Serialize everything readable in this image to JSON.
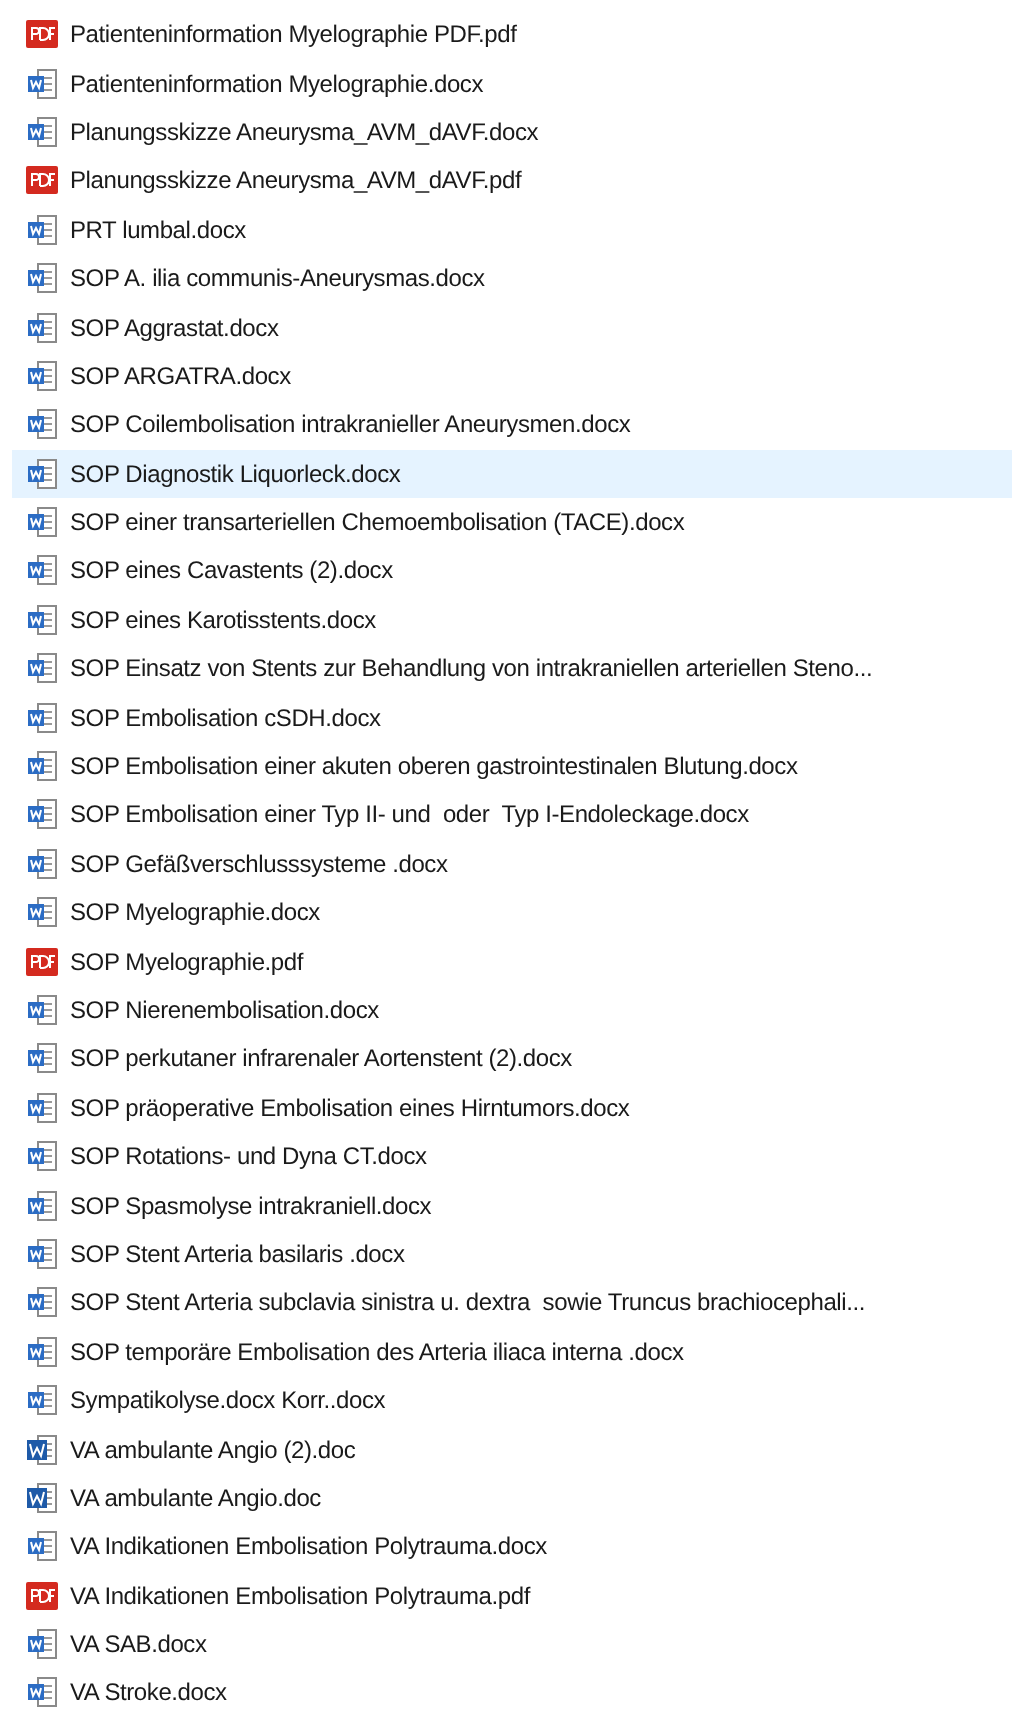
{
  "files": [
    {
      "name": "Patienteninformation Myelographie PDF.pdf",
      "kind": "pdf",
      "selected": false
    },
    {
      "name": "Patienteninformation Myelographie.docx",
      "kind": "docx",
      "selected": false
    },
    {
      "name": "Planungsskizze Aneurysma_AVM_dAVF.docx",
      "kind": "docx",
      "selected": false
    },
    {
      "name": "Planungsskizze Aneurysma_AVM_dAVF.pdf",
      "kind": "pdf",
      "selected": false
    },
    {
      "name": "PRT lumbal.docx",
      "kind": "docx",
      "selected": false
    },
    {
      "name": "SOP A. ilia communis-Aneurysmas.docx",
      "kind": "docx",
      "selected": false
    },
    {
      "name": "SOP Aggrastat.docx",
      "kind": "docx",
      "selected": false
    },
    {
      "name": "SOP ARGATRA.docx",
      "kind": "docx",
      "selected": false
    },
    {
      "name": "SOP Coilembolisation intrakranieller Aneurysmen.docx",
      "kind": "docx",
      "selected": false
    },
    {
      "name": "SOP Diagnostik Liquorleck.docx",
      "kind": "docx",
      "selected": true
    },
    {
      "name": "SOP einer transarteriellen Chemoembolisation (TACE).docx",
      "kind": "docx",
      "selected": false
    },
    {
      "name": "SOP eines Cavastents (2).docx",
      "kind": "docx",
      "selected": false
    },
    {
      "name": "SOP eines Karotisstents.docx",
      "kind": "docx",
      "selected": false
    },
    {
      "name": "SOP Einsatz von Stents zur Behandlung von intrakraniellen arteriellen Steno...",
      "kind": "docx",
      "selected": false
    },
    {
      "name": "SOP Embolisation cSDH.docx",
      "kind": "docx",
      "selected": false
    },
    {
      "name": "SOP Embolisation einer akuten oberen gastrointestinalen Blutung.docx",
      "kind": "docx",
      "selected": false
    },
    {
      "name": "SOP Embolisation einer Typ II- und  oder  Typ I-Endoleckage.docx",
      "kind": "docx",
      "selected": false
    },
    {
      "name": "SOP Gefäßverschlusssysteme .docx",
      "kind": "docx",
      "selected": false
    },
    {
      "name": "SOP Myelographie.docx",
      "kind": "docx",
      "selected": false
    },
    {
      "name": "SOP Myelographie.pdf",
      "kind": "pdf",
      "selected": false
    },
    {
      "name": "SOP Nierenembolisation.docx",
      "kind": "docx",
      "selected": false
    },
    {
      "name": "SOP perkutaner infrarenaler Aortenstent (2).docx",
      "kind": "docx",
      "selected": false
    },
    {
      "name": "SOP präoperative Embolisation eines Hirntumors.docx",
      "kind": "docx",
      "selected": false
    },
    {
      "name": "SOP Rotations- und Dyna CT.docx",
      "kind": "docx",
      "selected": false
    },
    {
      "name": "SOP Spasmolyse intrakraniell.docx",
      "kind": "docx",
      "selected": false
    },
    {
      "name": "SOP Stent Arteria basilaris .docx",
      "kind": "docx",
      "selected": false
    },
    {
      "name": "SOP Stent Arteria subclavia sinistra u. dextra  sowie Truncus brachiocephali...",
      "kind": "docx",
      "selected": false
    },
    {
      "name": "SOP temporäre Embolisation des Arteria iliaca interna .docx",
      "kind": "docx",
      "selected": false
    },
    {
      "name": "Sympatikolyse.docx Korr..docx",
      "kind": "docx",
      "selected": false
    },
    {
      "name": "VA ambulante Angio (2).doc",
      "kind": "doc",
      "selected": false
    },
    {
      "name": "VA ambulante Angio.doc",
      "kind": "doc",
      "selected": false
    },
    {
      "name": "VA Indikationen Embolisation Polytrauma.docx",
      "kind": "docx",
      "selected": false
    },
    {
      "name": "VA Indikationen Embolisation Polytrauma.pdf",
      "kind": "pdf",
      "selected": false
    },
    {
      "name": "VA SAB.docx",
      "kind": "docx",
      "selected": false
    },
    {
      "name": "VA Stroke.docx",
      "kind": "docx",
      "selected": false
    }
  ]
}
